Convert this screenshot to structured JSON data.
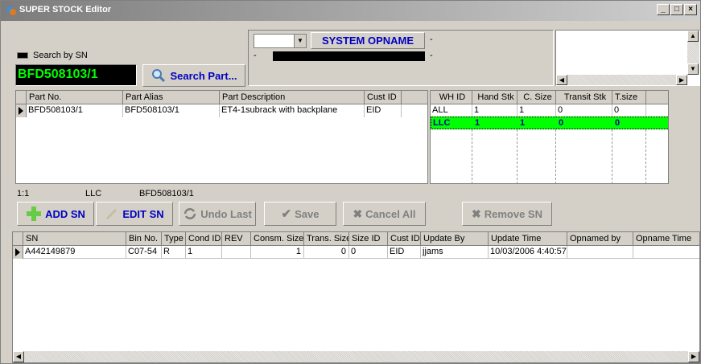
{
  "window": {
    "title": "SUPER STOCK Editor"
  },
  "top": {
    "search_by_sn_label": "Search by SN",
    "sn_value": "BFD508103/1",
    "search_part_label": "Search Part...",
    "system_opname_label": "SYSTEM OPNAME",
    "dot1": "-",
    "dot2": "-",
    "dot3": "-"
  },
  "part_table": {
    "headers": [
      "Part No.",
      "Part Alias",
      "Part Description",
      "Cust ID"
    ],
    "rows": [
      [
        "BFD508103/1",
        "BFD508103/1",
        "ET4-1subrack with backplane",
        "EID"
      ]
    ]
  },
  "wh_table": {
    "headers": [
      "WH ID",
      "Hand Stk",
      "C. Size",
      "Transit Stk",
      "T.size"
    ],
    "rows": [
      [
        "ALL",
        "1",
        "1",
        "0",
        "0"
      ],
      [
        "LLC",
        "1",
        "1",
        "0",
        "0"
      ]
    ],
    "highlight_color": "#00ff00"
  },
  "status": {
    "position": "1:1",
    "wh": "LLC",
    "part": "BFD508103/1"
  },
  "buttons": {
    "add_sn": "ADD SN",
    "edit_sn": "EDIT SN",
    "undo_last": "Undo Last",
    "save": "Save",
    "cancel_all": "Cancel All",
    "remove_sn": "Remove SN"
  },
  "sn_table": {
    "headers": [
      "SN",
      "Bin No.",
      "Type",
      "Cond ID",
      "REV",
      "Consm. Size",
      "Trans. Size",
      "Size ID",
      "Cust ID",
      "Update By",
      "Update Time",
      "Opnamed by",
      "Opname Time"
    ],
    "rows": [
      [
        "A442149879",
        "C07-54",
        "R",
        "1",
        "",
        "1",
        "0",
        "0",
        "EID",
        "jjams",
        "10/03/2006 4:40:57",
        "",
        ""
      ]
    ]
  }
}
